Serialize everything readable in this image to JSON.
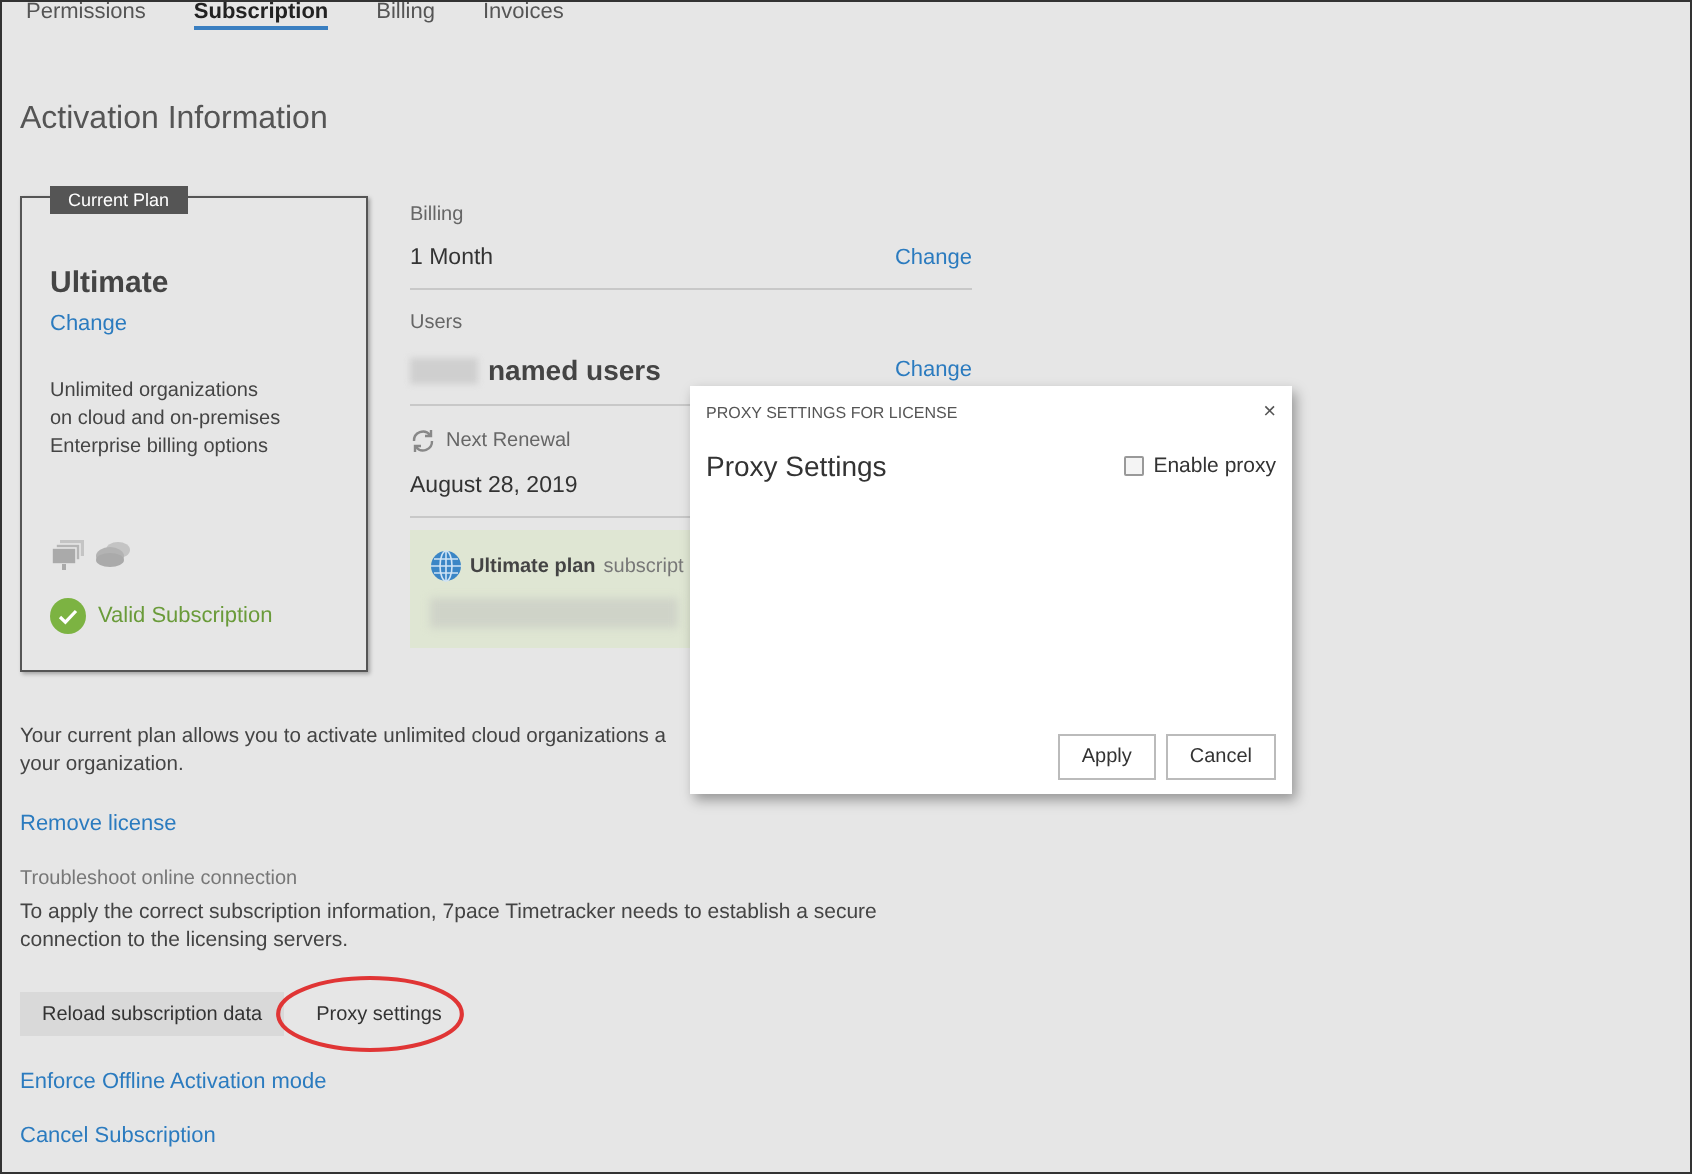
{
  "tabs": [
    {
      "label": "Permissions",
      "selected": false
    },
    {
      "label": "Subscription",
      "selected": true
    },
    {
      "label": "Billing",
      "selected": false
    },
    {
      "label": "Invoices",
      "selected": false
    }
  ],
  "heading": "Activation Information",
  "plan_card": {
    "badge": "Current Plan",
    "name": "Ultimate",
    "change_link": "Change",
    "features": [
      "Unlimited organizations",
      "on cloud and on-premises",
      "Enterprise billing options"
    ],
    "status": "Valid Subscription"
  },
  "details": {
    "billing": {
      "label": "Billing",
      "value": "1 Month",
      "change_link": "Change"
    },
    "users": {
      "label": "Users",
      "value": "named users",
      "change_link": "Change"
    },
    "renewal": {
      "label": "Next Renewal",
      "value": "August 28, 2019"
    },
    "plan_notice": {
      "name": "Ultimate plan",
      "text": "subscript"
    }
  },
  "description": [
    "Your current plan allows you to activate unlimited cloud organizations a",
    "your organization."
  ],
  "remove_license": "Remove license",
  "troubleshoot": {
    "title": "Troubleshoot online connection",
    "text": "To apply the correct subscription information, 7pace Timetracker needs to establish a secure connection to the licensing servers.",
    "buttons": [
      {
        "label": "Reload subscription data",
        "kind": "filled",
        "highlighted": false
      },
      {
        "label": "Proxy settings",
        "kind": "plain",
        "highlighted": true
      }
    ]
  },
  "links": [
    "Enforce Offline Activation mode",
    "Cancel Subscription"
  ],
  "dialog": {
    "caption": "PROXY SETTINGS FOR LICENSE",
    "close": "×",
    "title": "Proxy Settings",
    "enable_proxy": {
      "label": "Enable proxy",
      "checked": false
    },
    "buttons": [
      "Apply",
      "Cancel"
    ]
  }
}
